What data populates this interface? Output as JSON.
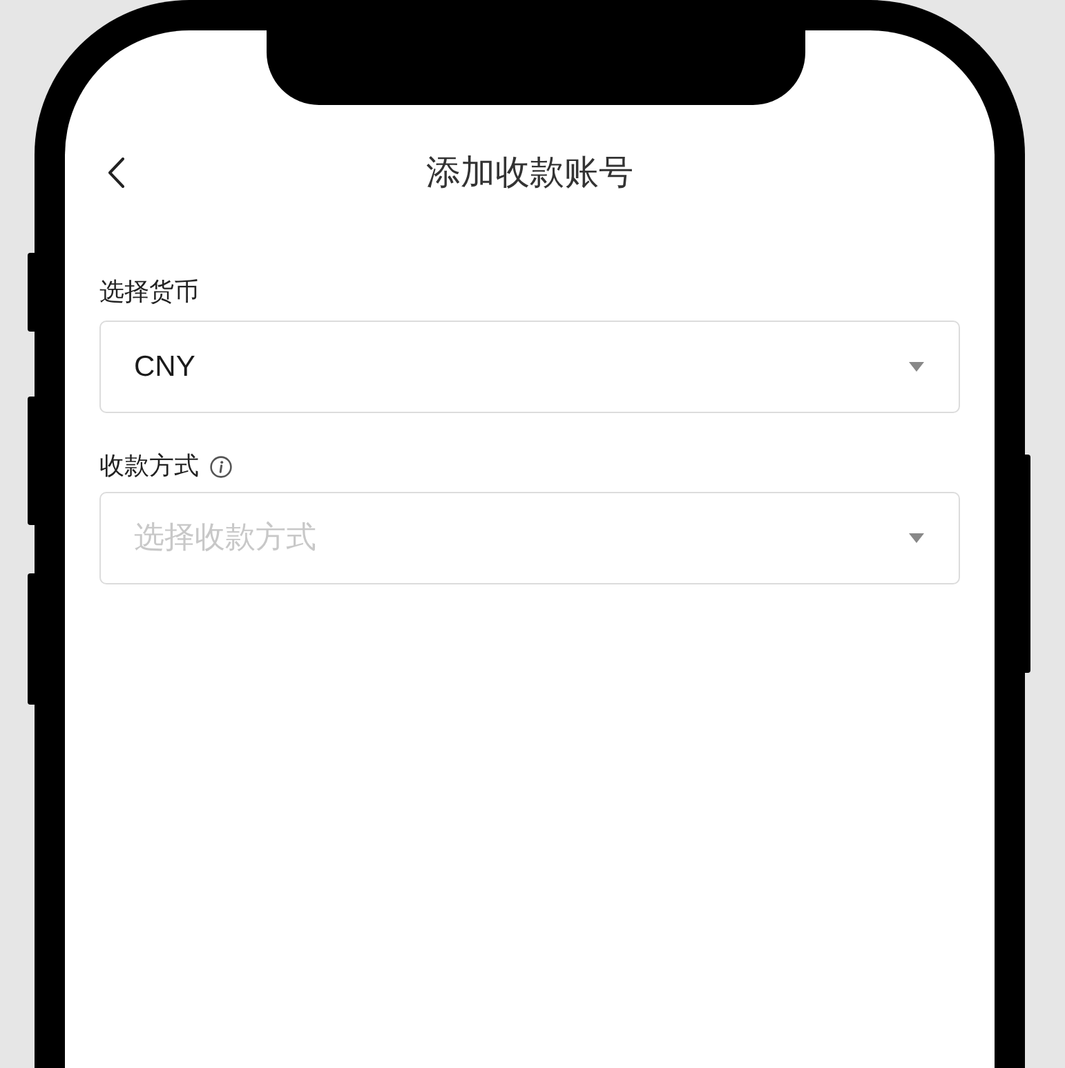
{
  "header": {
    "title": "添加收款账号"
  },
  "fields": [
    {
      "label": "选择货币",
      "value": "CNY",
      "info": false
    },
    {
      "label": "收款方式",
      "placeholder": "选择收款方式",
      "info": true
    }
  ]
}
